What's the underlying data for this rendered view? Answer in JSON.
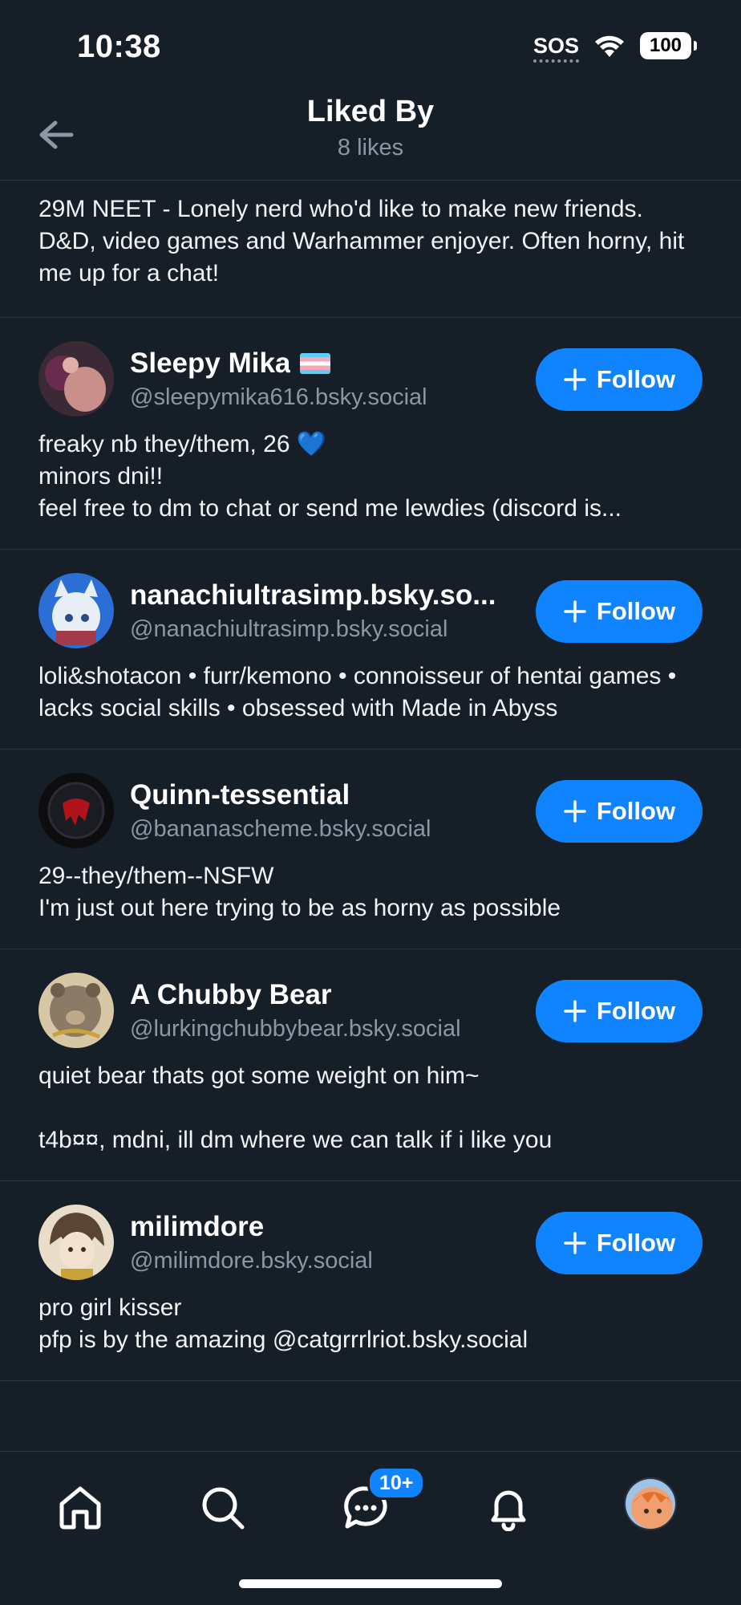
{
  "status_bar": {
    "time": "10:38",
    "sos": "SOS",
    "battery": "100"
  },
  "header": {
    "title": "Liked By",
    "subtitle": "8 likes",
    "back_icon": "arrow-left-icon"
  },
  "top_bio": "29M NEET - Lonely nerd who'd like to make new friends. D&D, video games and Warhammer enjoyer. Often horny, hit me up for a chat!",
  "follow_label": "Follow",
  "users": [
    {
      "display_name": "Sleepy Mika",
      "handle": "@sleepymika616.bsky.social",
      "bio": "freaky nb they/them, 26 💙\nminors dni!!\nfeel free to dm to chat or send me lewdies (discord is...",
      "avatar_colors": [
        "#3b2a35",
        "#c98f8b"
      ]
    },
    {
      "display_name": "nanachiultrasimp.bsky.so...",
      "handle": "@nanachiultrasimp.bsky.social",
      "bio": "loli&shotacon • furr/kemono • connoisseur of hentai games • lacks social skills • obsessed with Made in Abyss",
      "avatar_colors": [
        "#2b6fd6",
        "#e8eef5"
      ]
    },
    {
      "display_name": "Quinn-tessential",
      "handle": "@bananascheme.bsky.social",
      "bio": "29--they/them--NSFW\nI'm just out here trying to be as horny as possible",
      "avatar_colors": [
        "#0d0d10",
        "#b0141a"
      ]
    },
    {
      "display_name": "A Chubby Bear",
      "handle": "@lurkingchubbybear.bsky.social",
      "bio": "quiet bear thats got some weight on him~\n\nt4b¤¤, mdni, ill dm where we can talk if i like you",
      "avatar_colors": [
        "#8a7a66",
        "#d8c7a4"
      ]
    },
    {
      "display_name": "milimdore",
      "handle": "@milimdore.bsky.social",
      "bio": "pro girl kisser\npfp is by the amazing @catgrrrlriot.bsky.social",
      "avatar_colors": [
        "#5a4535",
        "#e9dcc9"
      ]
    }
  ],
  "nav": {
    "home_icon": "home-icon",
    "search_icon": "search-icon",
    "chat_icon": "chat-icon",
    "chat_badge": "10+",
    "notifications_icon": "bell-icon",
    "profile_icon": "avatar"
  },
  "colors": {
    "background": "#161e27",
    "accent": "#1083fe",
    "muted_text": "#8a97a5"
  }
}
